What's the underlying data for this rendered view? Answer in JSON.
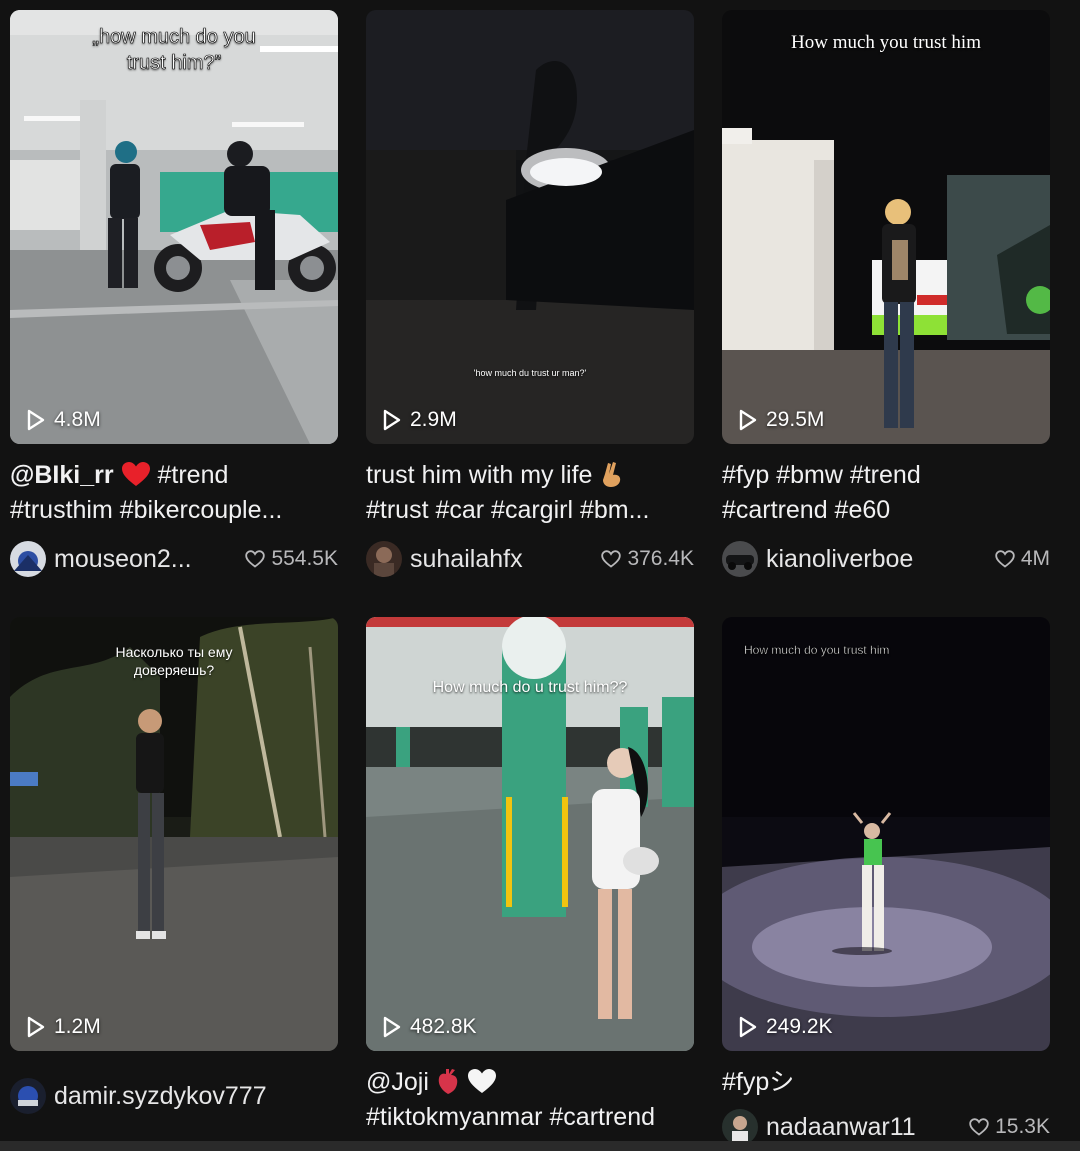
{
  "videos": [
    {
      "overlay": "„how much do you trust him?”",
      "views": "4.8M",
      "caption_a": "@BIki_rr",
      "caption_b": " #trend",
      "caption_c": "#trusthim #bikercouple...",
      "author": "mouseon2...",
      "likes": "554.5K"
    },
    {
      "overlay": "'how much du trust ur man?'",
      "views": "2.9M",
      "caption_a": "trust him with my life",
      "caption_b": "#trust #car #cargirl #bm...",
      "author": "suhailahfx",
      "likes": "376.4K"
    },
    {
      "overlay": "How much you trust him",
      "views": "29.5M",
      "caption_a": "#fyp #bmw #trend",
      "caption_b": "#cartrend #e60",
      "author": "kianoliverboe",
      "likes": "4M"
    },
    {
      "overlay": "Насколько ты ему доверяешь?",
      "views": "1.2M",
      "author": "damir.syzdykov777"
    },
    {
      "overlay": "How much do u trust him??",
      "views": "482.8K",
      "caption_a": "@Joji",
      "caption_b": "#tiktokmyanmar #cartrend"
    },
    {
      "overlay": "How much do you trust him",
      "views": "249.2K",
      "caption_a": "#fypシ",
      "author": "nadaanwar11",
      "likes": "15.3K"
    }
  ],
  "colors": {
    "background": "#121212",
    "text": "#f1f1f2",
    "muted": "#b8b8ba"
  }
}
